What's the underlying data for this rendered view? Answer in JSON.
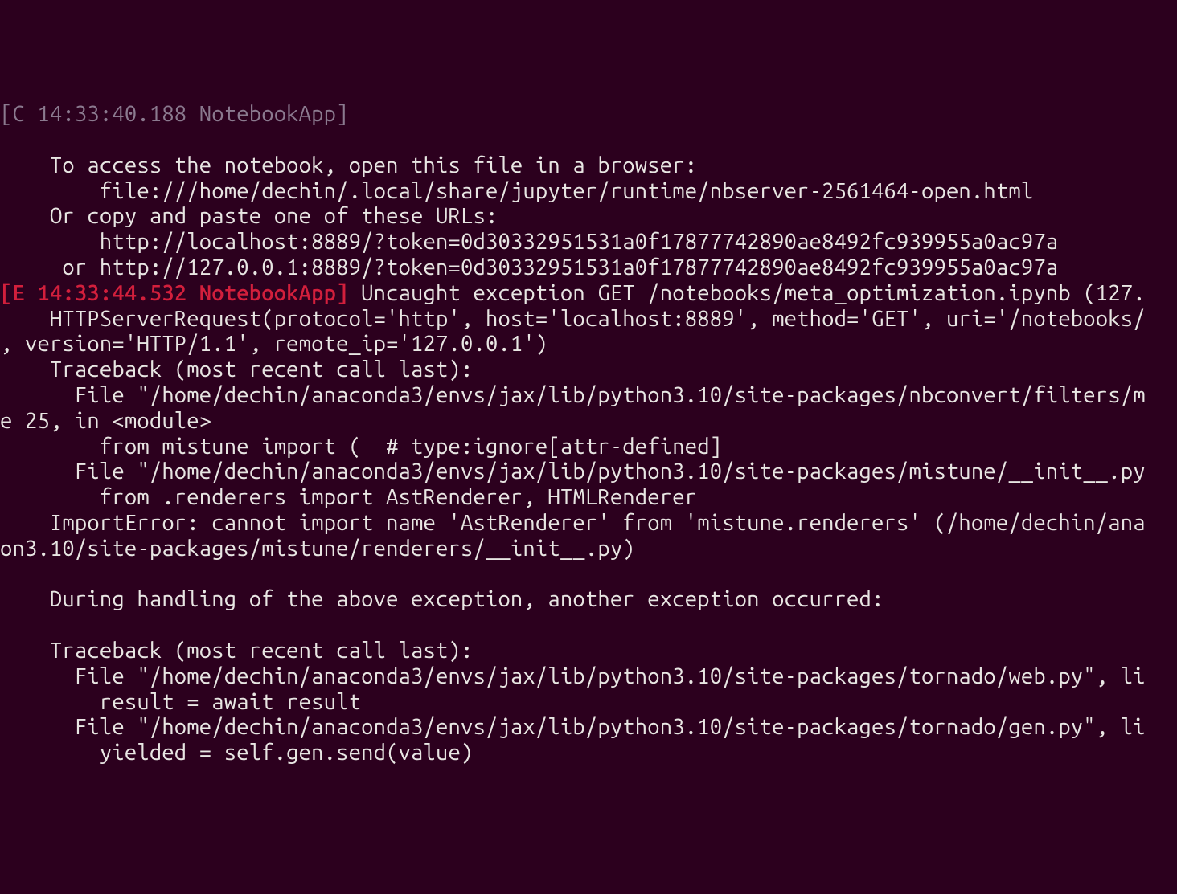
{
  "lines": [
    {
      "cls": "info-stamp",
      "text": "[C 14:33:40.188 NotebookApp]"
    },
    {
      "cls": "normal",
      "text": ""
    },
    {
      "cls": "normal",
      "text": "    To access the notebook, open this file in a browser:"
    },
    {
      "cls": "normal",
      "text": "        file:///home/dechin/.local/share/jupyter/runtime/nbserver-2561464-open.html"
    },
    {
      "cls": "normal",
      "text": "    Or copy and paste one of these URLs:"
    },
    {
      "cls": "normal",
      "text": "        http://localhost:8889/?token=0d30332951531a0f17877742890ae8492fc939955a0ac97a"
    },
    {
      "cls": "normal",
      "text": "     or http://127.0.0.1:8889/?token=0d30332951531a0f17877742890ae8492fc939955a0ac97a"
    },
    {
      "cls": "err-mixed",
      "stamp": "[E 14:33:44.532 NotebookApp]",
      "rest": " Uncaught exception GET /notebooks/meta_optimization.ipynb (127."
    },
    {
      "cls": "normal",
      "text": "    HTTPServerRequest(protocol='http', host='localhost:8889', method='GET', uri='/notebooks/"
    },
    {
      "cls": "normal",
      "text": ", version='HTTP/1.1', remote_ip='127.0.0.1')"
    },
    {
      "cls": "normal",
      "text": "    Traceback (most recent call last):"
    },
    {
      "cls": "normal",
      "text": "      File \"/home/dechin/anaconda3/envs/jax/lib/python3.10/site-packages/nbconvert/filters/m"
    },
    {
      "cls": "normal",
      "text": "e 25, in <module>"
    },
    {
      "cls": "normal",
      "text": "        from mistune import (  # type:ignore[attr-defined]"
    },
    {
      "cls": "normal",
      "text": "      File \"/home/dechin/anaconda3/envs/jax/lib/python3.10/site-packages/mistune/__init__.py"
    },
    {
      "cls": "normal",
      "text": "        from .renderers import AstRenderer, HTMLRenderer"
    },
    {
      "cls": "normal",
      "text": "    ImportError: cannot import name 'AstRenderer' from 'mistune.renderers' (/home/dechin/ana"
    },
    {
      "cls": "normal",
      "text": "on3.10/site-packages/mistune/renderers/__init__.py)"
    },
    {
      "cls": "normal",
      "text": "    "
    },
    {
      "cls": "normal",
      "text": "    During handling of the above exception, another exception occurred:"
    },
    {
      "cls": "normal",
      "text": "    "
    },
    {
      "cls": "normal",
      "text": "    Traceback (most recent call last):"
    },
    {
      "cls": "normal",
      "text": "      File \"/home/dechin/anaconda3/envs/jax/lib/python3.10/site-packages/tornado/web.py\", li"
    },
    {
      "cls": "normal",
      "text": "        result = await result"
    },
    {
      "cls": "normal",
      "text": "      File \"/home/dechin/anaconda3/envs/jax/lib/python3.10/site-packages/tornado/gen.py\", li"
    },
    {
      "cls": "normal",
      "text": "        yielded = self.gen.send(value)"
    }
  ]
}
